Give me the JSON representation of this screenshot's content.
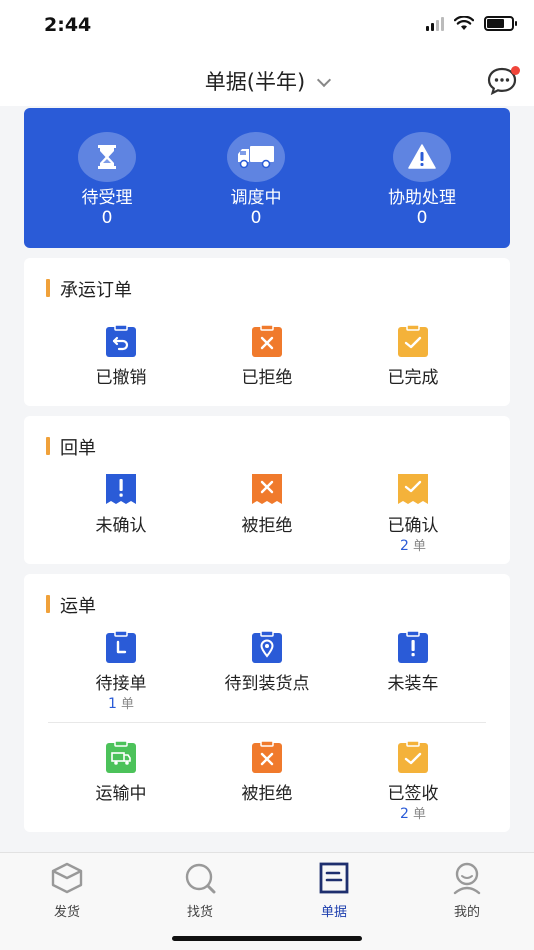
{
  "status_bar": {
    "time": "2:44"
  },
  "header": {
    "title": "单据(半年)"
  },
  "summary": [
    {
      "label": "待受理",
      "count": "0",
      "icon": "hourglass-icon"
    },
    {
      "label": "调度中",
      "count": "0",
      "icon": "truck-icon"
    },
    {
      "label": "协助处理",
      "count": "0",
      "icon": "warning-icon"
    }
  ],
  "sections": {
    "carrier_orders": {
      "title": "承运订单",
      "items": [
        {
          "label": "已撤销",
          "icon": "undo-clipboard-icon",
          "color": "#2a5bd7"
        },
        {
          "label": "已拒绝",
          "icon": "x-clipboard-icon",
          "color": "#f07a2c"
        },
        {
          "label": "已完成",
          "icon": "check-clipboard-icon",
          "color": "#f4b23a"
        }
      ]
    },
    "receipts": {
      "title": "回单",
      "items": [
        {
          "label": "未确认",
          "icon": "exclamation-receipt-icon",
          "color": "#2a5bd7"
        },
        {
          "label": "被拒绝",
          "icon": "x-receipt-icon",
          "color": "#f07a2c"
        },
        {
          "label": "已确认",
          "icon": "check-receipt-icon",
          "color": "#f4b23a",
          "sub_count": "2",
          "sub_unit": "单"
        }
      ]
    },
    "waybills": {
      "title": "运单",
      "items": [
        {
          "label": "待接单",
          "icon": "clock-clipboard-icon",
          "color": "#2a5bd7",
          "sub_count": "1",
          "sub_unit": "单"
        },
        {
          "label": "待到装货点",
          "icon": "location-clipboard-icon",
          "color": "#2a5bd7"
        },
        {
          "label": "未装车",
          "icon": "exclamation-clipboard-icon",
          "color": "#2a5bd7"
        },
        {
          "label": "运输中",
          "icon": "truck-clipboard-icon",
          "color": "#4cc25a"
        },
        {
          "label": "被拒绝",
          "icon": "x-clipboard-icon",
          "color": "#f07a2c"
        },
        {
          "label": "已签收",
          "icon": "check-clipboard-icon",
          "color": "#f4b23a",
          "sub_count": "2",
          "sub_unit": "单"
        }
      ]
    }
  },
  "tabs": [
    {
      "label": "发货",
      "icon": "box-icon",
      "active": false
    },
    {
      "label": "找货",
      "icon": "search-icon",
      "active": false
    },
    {
      "label": "单据",
      "icon": "document-icon",
      "active": true
    },
    {
      "label": "我的",
      "icon": "user-icon",
      "active": false
    }
  ],
  "colors": {
    "primary": "#2a5bd7",
    "accent_bar": "#f0a13a",
    "orange": "#f07a2c",
    "yellow": "#f4b23a",
    "green": "#4cc25a",
    "badge": "#f0453a"
  }
}
